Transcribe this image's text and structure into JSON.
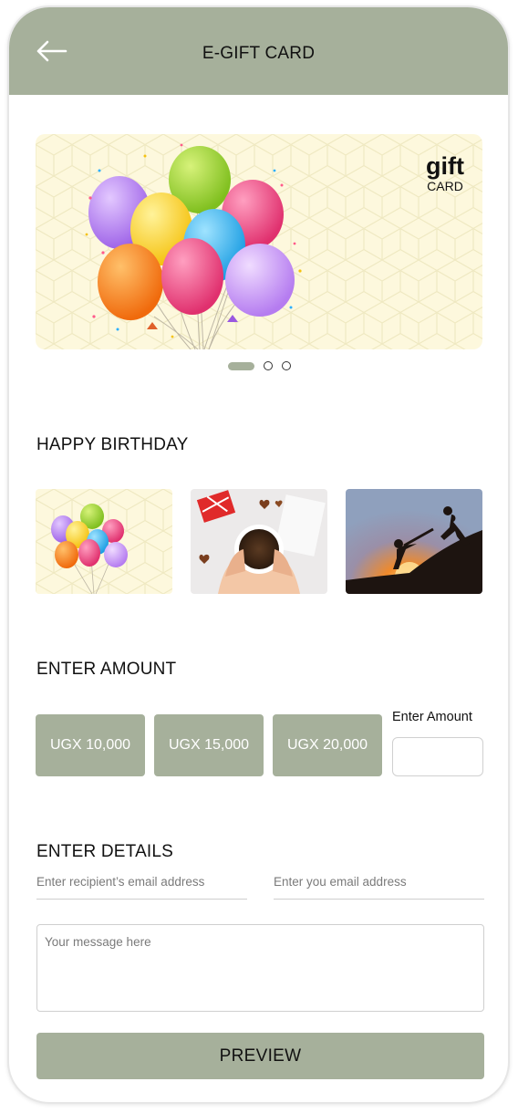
{
  "header": {
    "title": "E-GIFT CARD",
    "back_icon": "arrow-left-icon"
  },
  "hero_card": {
    "brand_main": "gift",
    "brand_sub": "CARD",
    "slides": 3,
    "active_slide": 1
  },
  "occasion": {
    "title": "HAPPY BIRTHDAY",
    "thumbnails": [
      "balloons",
      "coffee-and-chocolates",
      "helping-hand-sunset"
    ]
  },
  "amount": {
    "title": "ENTER AMOUNT",
    "options": [
      "UGX 10,000",
      "UGX 15,000",
      "UGX 20,000"
    ],
    "custom_label": "Enter Amount",
    "custom_value": ""
  },
  "details": {
    "title": "ENTER DETAILS",
    "recipient_placeholder": "Enter recipient’s email address",
    "sender_placeholder": "Enter you email address",
    "message_placeholder": "Your message here"
  },
  "actions": {
    "preview_label": "PREVIEW"
  },
  "colors": {
    "accent": "#a6b09b",
    "card_bg": "#fdf8dd"
  }
}
